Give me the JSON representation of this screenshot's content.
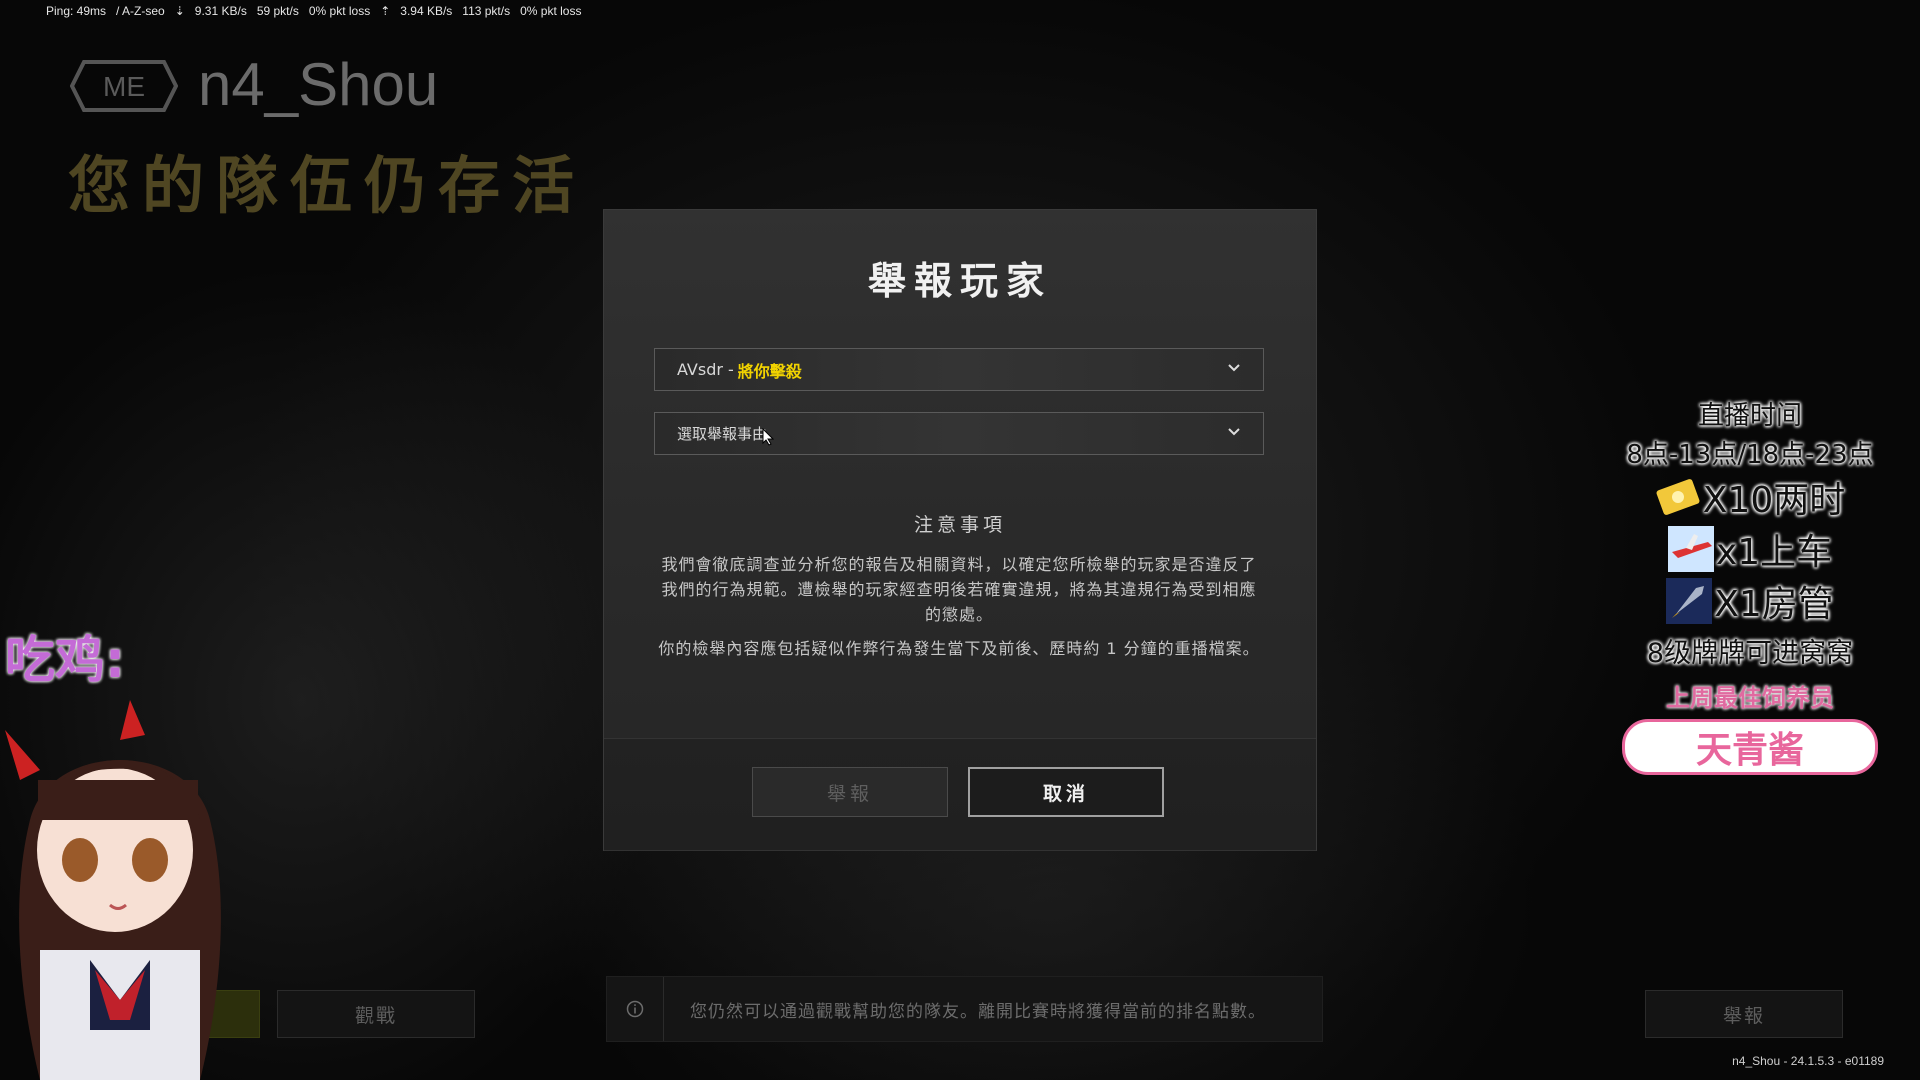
{
  "netstats": {
    "ping": "Ping: 49ms",
    "region": "/ A-Z-seo",
    "down_rate": "9.31 KB/s",
    "down_pkt": "59 pkt/s",
    "down_loss": "0% pkt loss",
    "up_rate": "3.94 KB/s",
    "up_pkt": "113 pkt/s",
    "up_loss": "0% pkt loss"
  },
  "player": {
    "badge": "ME",
    "name": "n4_Shou",
    "status": "您的隊伍仍存活"
  },
  "dialog": {
    "title": "舉報玩家",
    "player_select_name": "AVsdr -",
    "player_select_detail": "將你擊殺",
    "reason_placeholder": "選取舉報事由",
    "notice_title": "注意事項",
    "notice_p1": "我們會徹底調查並分析您的報告及相關資料，以確定您所檢舉的玩家是否違反了我們的行為規範。遭檢舉的玩家經查明後若確實違規，將為其違規行為受到相應的懲處。",
    "notice_p2": "你的檢舉內容應包括疑似作弊行為發生當下及前後、歷時約 1 分鐘的重播檔案。",
    "report_button": "舉報",
    "cancel_button": "取消"
  },
  "bottom": {
    "spectate_button": "觀戰",
    "info_text": "您仍然可以通過觀戰幫助您的隊友。離開比賽時將獲得當前的排名點數。",
    "report_button": "舉報"
  },
  "version": "n4_Shou - 24.1.5.3 - e01189",
  "stream_overlay": {
    "time_label": "直播时间",
    "time_value": "8点-13点/18点-23点",
    "gift1": "X10两时",
    "gift2": "x1上车",
    "gift3": "X1房管",
    "level_note": "8级牌牌可进窝窝",
    "best_label": "上周最佳饲养员",
    "best_name": "天青酱",
    "chicken_label": "吃鸡:"
  },
  "colors": {
    "accent_yellow": "#f1d200",
    "dialog_bg": "#2d2d2d",
    "stream_pink": "#e8669c"
  }
}
